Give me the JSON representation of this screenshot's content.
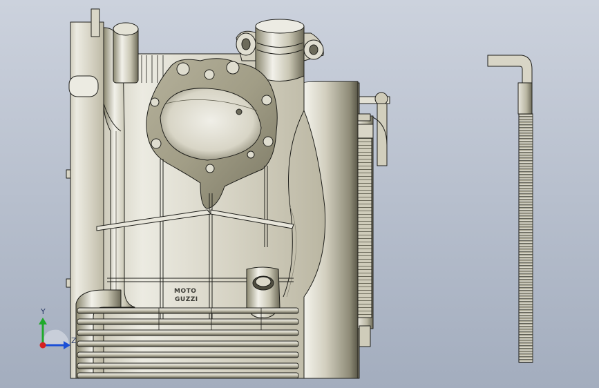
{
  "part": {
    "engraving_line1": "MOTO",
    "engraving_line2": "GUZZI"
  },
  "triad": {
    "y_label": "Y",
    "z_label": "Z",
    "colors": {
      "y": "#1faa2a",
      "z": "#1b4fd6",
      "x": "#d62020"
    }
  },
  "colors": {
    "background_top": "#ccd2dd",
    "background_bottom": "#a3adbe",
    "metal_light": "#e6e3d6",
    "metal_mid": "#bdb9a6",
    "metal_dark": "#6f6c5c",
    "edge": "#1e1e1a"
  }
}
